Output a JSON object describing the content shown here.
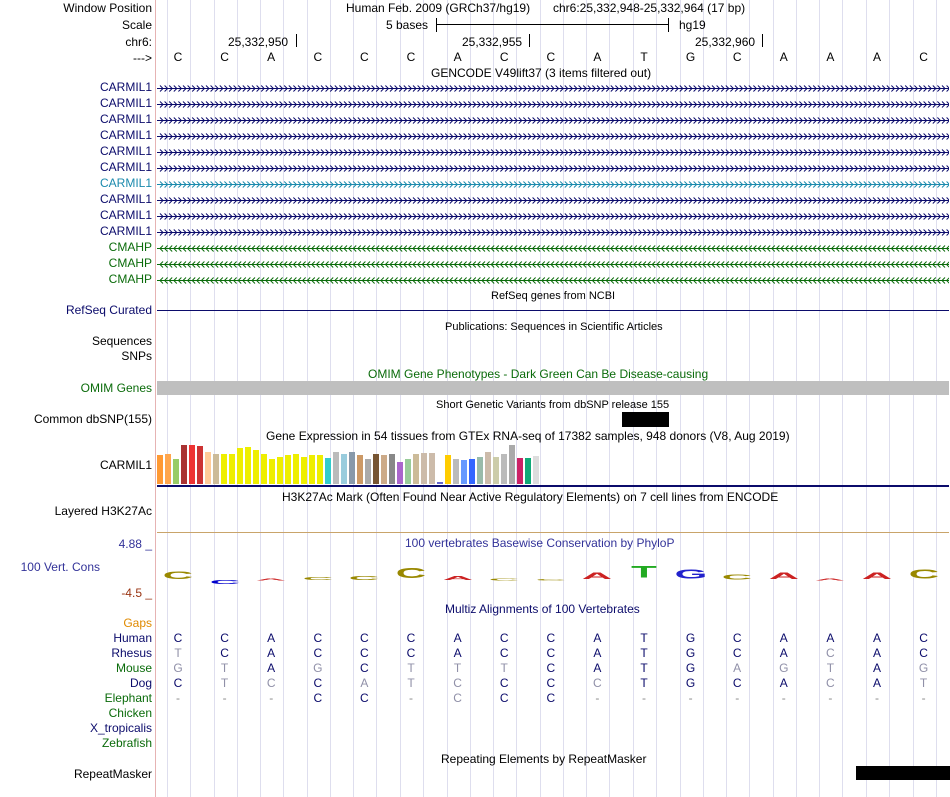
{
  "header": {
    "window_position_label": "Window Position",
    "scale_label": "Scale",
    "chrom_label": "chr6:",
    "strand_label": "--->",
    "assembly": "Human Feb. 2009 (GRCh37/hg19)",
    "position": "chr6:25,332,948-25,332,964 (17 bp)",
    "scale_text": "5 bases",
    "scale_db": "hg19",
    "coords": [
      "25,332,950",
      "25,332,955",
      "25,332,960"
    ]
  },
  "sequence": [
    "C",
    "C",
    "A",
    "C",
    "C",
    "C",
    "A",
    "C",
    "C",
    "A",
    "T",
    "G",
    "C",
    "A",
    "A",
    "A",
    "C"
  ],
  "gencode": {
    "title": "GENCODE V49lift37 (3 items filtered out)",
    "tracks": [
      {
        "name": "CARMIL1",
        "color": "#0b0b6b",
        "strand": "+"
      },
      {
        "name": "CARMIL1",
        "color": "#0b0b6b",
        "strand": "+"
      },
      {
        "name": "CARMIL1",
        "color": "#0b0b6b",
        "strand": "+"
      },
      {
        "name": "CARMIL1",
        "color": "#0b0b6b",
        "strand": "+"
      },
      {
        "name": "CARMIL1",
        "color": "#0b0b6b",
        "strand": "+"
      },
      {
        "name": "CARMIL1",
        "color": "#0b0b6b",
        "strand": "+"
      },
      {
        "name": "CARMIL1",
        "color": "#1b8aad",
        "strand": "+"
      },
      {
        "name": "CARMIL1",
        "color": "#0b0b6b",
        "strand": "+"
      },
      {
        "name": "CARMIL1",
        "color": "#0b0b6b",
        "strand": "+"
      },
      {
        "name": "CARMIL1",
        "color": "#0b0b6b",
        "strand": "+"
      },
      {
        "name": "CMAHP",
        "color": "#0a6b0a",
        "strand": "-"
      },
      {
        "name": "CMAHP",
        "color": "#0a6b0a",
        "strand": "-"
      },
      {
        "name": "CMAHP",
        "color": "#0a6b0a",
        "strand": "-"
      }
    ]
  },
  "refseq": {
    "label": "RefSeq Curated",
    "title": "RefSeq genes from NCBI"
  },
  "publications": {
    "label1": "Sequences",
    "label2": "SNPs",
    "title": "Publications: Sequences in Scientific Articles"
  },
  "omim": {
    "label": "OMIM Genes",
    "title": "OMIM Gene Phenotypes - Dark Green Can Be Disease-causing"
  },
  "dbsnp": {
    "label": "Common dbSNP(155)",
    "title": "Short Genetic Variants from dbSNP release 155"
  },
  "gtex": {
    "label": "CARMIL1",
    "title": "Gene Expression in 54 tissues from GTEx RNA-seq of 17382 samples, 948 donors (V8, Aug 2019)",
    "bars": [
      {
        "v": 0.7,
        "c": "#ff9933"
      },
      {
        "v": 0.74,
        "c": "#ffa64d"
      },
      {
        "v": 0.62,
        "c": "#99cc66"
      },
      {
        "v": 0.96,
        "c": "#aa3333"
      },
      {
        "v": 0.94,
        "c": "#ee3333"
      },
      {
        "v": 0.92,
        "c": "#cc3333"
      },
      {
        "v": 0.78,
        "c": "#ffcc99"
      },
      {
        "v": 0.72,
        "c": "#ccbb99"
      },
      {
        "v": 0.72,
        "c": "#eeee00"
      },
      {
        "v": 0.74,
        "c": "#eeee00"
      },
      {
        "v": 0.88,
        "c": "#eeee00"
      },
      {
        "v": 0.9,
        "c": "#eeee00"
      },
      {
        "v": 0.82,
        "c": "#eeee00"
      },
      {
        "v": 0.74,
        "c": "#eeee00"
      },
      {
        "v": 0.62,
        "c": "#eeee00"
      },
      {
        "v": 0.66,
        "c": "#eeee00"
      },
      {
        "v": 0.7,
        "c": "#eeee00"
      },
      {
        "v": 0.74,
        "c": "#eeee00"
      },
      {
        "v": 0.66,
        "c": "#eeee00"
      },
      {
        "v": 0.7,
        "c": "#eeee00"
      },
      {
        "v": 0.7,
        "c": "#eeee00"
      },
      {
        "v": 0.64,
        "c": "#33cccc"
      },
      {
        "v": 0.78,
        "c": "#bbbbbb"
      },
      {
        "v": 0.74,
        "c": "#99ccdd"
      },
      {
        "v": 0.78,
        "c": "#8899aa"
      },
      {
        "v": 0.7,
        "c": "#cc9966"
      },
      {
        "v": 0.6,
        "c": "#aaaaaa"
      },
      {
        "v": 0.72,
        "c": "#775533"
      },
      {
        "v": 0.7,
        "c": "#ccaa88"
      },
      {
        "v": 0.74,
        "c": "#888888"
      },
      {
        "v": 0.54,
        "c": "#aa66cc"
      },
      {
        "v": 0.62,
        "c": "#99cc99"
      },
      {
        "v": 0.72,
        "c": "#ccbb99"
      },
      {
        "v": 0.76,
        "c": "#ccbbaa"
      },
      {
        "v": 0.76,
        "c": "#ccbbaa"
      },
      {
        "v": 0.04,
        "c": "#6666cc"
      },
      {
        "v": 0.7,
        "c": "#ffcc00"
      },
      {
        "v": 0.6,
        "c": "#bbbbbb"
      },
      {
        "v": 0.58,
        "c": "#6699ff"
      },
      {
        "v": 0.6,
        "c": "#3366ff"
      },
      {
        "v": 0.66,
        "c": "#99bbaa"
      },
      {
        "v": 0.78,
        "c": "#ccbbaa"
      },
      {
        "v": 0.66,
        "c": "#ccccaa"
      },
      {
        "v": 0.74,
        "c": "#bbbbbb"
      },
      {
        "v": 0.94,
        "c": "#aaaaaa"
      },
      {
        "v": 0.64,
        "c": "#cc2266"
      },
      {
        "v": 0.64,
        "c": "#11aa77"
      },
      {
        "v": 0.68,
        "c": "#dddddd"
      }
    ]
  },
  "h3k27ac": {
    "label": "Layered H3K27Ac",
    "title": "H3K27Ac Mark (Often Found Near Active Regulatory Elements) on 7 cell lines from ENCODE"
  },
  "phylop": {
    "label": "100 Vert. Cons",
    "title": "100 vertebrates Basewise Conservation by PhyloP",
    "max": "4.88 _",
    "min": "-4.5 _",
    "logo": [
      {
        "b": "C",
        "c": "#998800",
        "s": 0.55,
        "d": "up"
      },
      {
        "b": "C",
        "c": "#0000cc",
        "s": 0.25,
        "d": "down"
      },
      {
        "b": "A",
        "c": "#cc2222",
        "s": 0.12,
        "d": "up"
      },
      {
        "b": "C",
        "c": "#998800",
        "s": 0.22,
        "d": "up"
      },
      {
        "b": "C",
        "c": "#998800",
        "s": 0.28,
        "d": "up"
      },
      {
        "b": "C",
        "c": "#998800",
        "s": 0.75,
        "d": "up"
      },
      {
        "b": "A",
        "c": "#cc2222",
        "s": 0.25,
        "d": "up"
      },
      {
        "b": "C",
        "c": "#998800",
        "s": 0.15,
        "d": "up"
      },
      {
        "b": "C",
        "c": "#998800",
        "s": 0.05,
        "d": "up"
      },
      {
        "b": "A",
        "c": "#cc2222",
        "s": 0.45,
        "d": "up"
      },
      {
        "b": "T",
        "c": "#22aa22",
        "s": 0.85,
        "d": "up"
      },
      {
        "b": "G",
        "c": "#2222cc",
        "s": 0.65,
        "d": "up"
      },
      {
        "b": "C",
        "c": "#998800",
        "s": 0.35,
        "d": "up"
      },
      {
        "b": "A",
        "c": "#cc2222",
        "s": 0.45,
        "d": "up"
      },
      {
        "b": "A",
        "c": "#cc2222",
        "s": 0.15,
        "d": "up"
      },
      {
        "b": "A",
        "c": "#cc2222",
        "s": 0.45,
        "d": "up"
      },
      {
        "b": "C",
        "c": "#998800",
        "s": 0.65,
        "d": "up"
      }
    ]
  },
  "multiz": {
    "title": "Multiz Alignments of 100 Vertebrates",
    "gaps_label": "Gaps",
    "species": [
      {
        "name": "Human",
        "color": "#0b0b6b",
        "bases": [
          "C",
          "C",
          "A",
          "C",
          "C",
          "C",
          "A",
          "C",
          "C",
          "A",
          "T",
          "G",
          "C",
          "A",
          "A",
          "A",
          "C"
        ]
      },
      {
        "name": "Rhesus",
        "color": "#0b0b6b",
        "bases": [
          "T",
          "C",
          "A",
          "C",
          "C",
          "C",
          "A",
          "C",
          "C",
          "A",
          "T",
          "G",
          "C",
          "A",
          "C",
          "A",
          "C"
        ]
      },
      {
        "name": "Mouse",
        "color": "#0a6b0a",
        "bases": [
          "G",
          "T",
          "A",
          "G",
          "C",
          "T",
          "T",
          "T",
          "C",
          "A",
          "T",
          "G",
          "A",
          "G",
          "T",
          "A",
          "G"
        ]
      },
      {
        "name": "Dog",
        "color": "#0b0b6b",
        "bases": [
          "C",
          "T",
          "C",
          "C",
          "A",
          "T",
          "C",
          "C",
          "C",
          "C",
          "T",
          "G",
          "C",
          "A",
          "C",
          "A",
          "T"
        ]
      },
      {
        "name": "Elephant",
        "color": "#0a6b0a",
        "bases": [
          "-",
          "-",
          "-",
          "C",
          "C",
          "-",
          "C",
          "C",
          "C",
          "-",
          "-",
          "-",
          "-",
          "-",
          "-",
          "-",
          "-"
        ]
      },
      {
        "name": "Chicken",
        "color": "#0a6b0a",
        "bases": []
      },
      {
        "name": "X_tropicalis",
        "color": "#0b0b6b",
        "bases": []
      },
      {
        "name": "Zebrafish",
        "color": "#0a6b0a",
        "bases": []
      }
    ]
  },
  "repeatmasker": {
    "label": "RepeatMasker",
    "title": "Repeating Elements by RepeatMasker"
  }
}
